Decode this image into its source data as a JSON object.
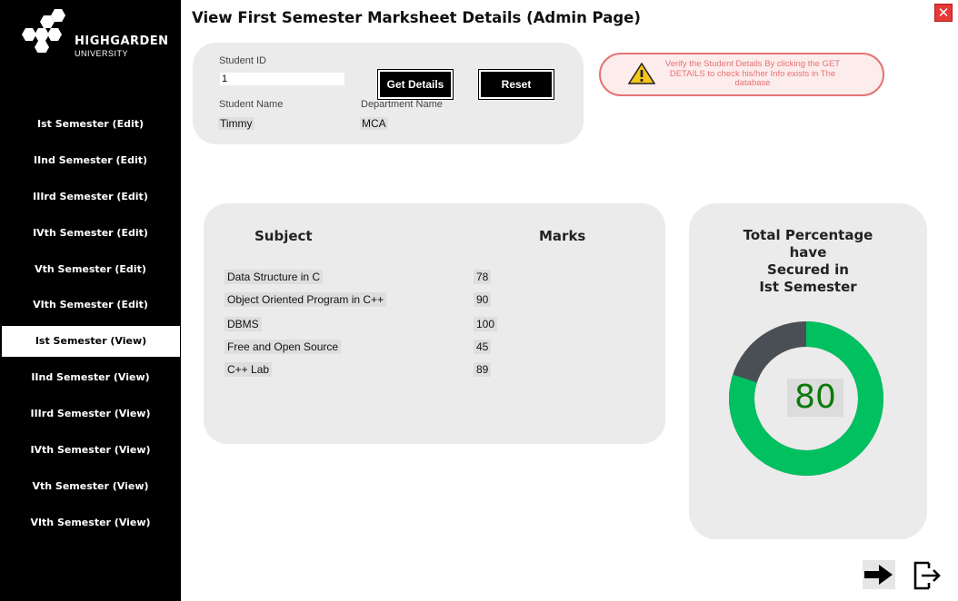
{
  "logo": {
    "name": "HIGHGARDEN",
    "sub": "UNIVERSITY"
  },
  "sidebar": {
    "items": [
      {
        "label": "Ist Semester (Edit)"
      },
      {
        "label": "IInd Semester (Edit)"
      },
      {
        "label": "IIIrd Semester (Edit)"
      },
      {
        "label": "IVth Semester (Edit)"
      },
      {
        "label": "Vth Semester (Edit)"
      },
      {
        "label": "VIth Semester (Edit)"
      },
      {
        "label": "Ist Semester (View)",
        "active": true
      },
      {
        "label": "IInd Semester (View)"
      },
      {
        "label": "IIIrd Semester (View)"
      },
      {
        "label": "IVth Semester (View)"
      },
      {
        "label": "Vth Semester (View)"
      },
      {
        "label": "VIth Semester (View)"
      }
    ]
  },
  "header": {
    "title": "View First Semester Marksheet Details (Admin Page)",
    "close_label": "✕"
  },
  "student": {
    "id_label": "Student ID",
    "id_value": "1",
    "name_label": "Student Name",
    "name_value": "Timmy",
    "dept_label": "Department Name",
    "dept_value": "MCA",
    "get_details_label": "Get Details",
    "reset_label": "Reset"
  },
  "warning": {
    "icon": "warning-icon",
    "text": "Verify the Student Details By clicking the GET DETAILS to check his/her Info exists in The database"
  },
  "marks": {
    "subject_header": "Subject",
    "marks_header": "Marks",
    "rows": [
      {
        "subject": "Data Structure in C",
        "marks": "78"
      },
      {
        "subject": "Object Oriented Program in C++",
        "marks": "90"
      },
      {
        "subject": "DBMS",
        "marks": "100"
      },
      {
        "subject": "Free and Open Source",
        "marks": "45"
      },
      {
        "subject": "C++ Lab",
        "marks": "89"
      }
    ]
  },
  "percentage": {
    "title_lines": [
      "Total Percentage",
      "have",
      "Secured in",
      "Ist Semester"
    ],
    "value": "80",
    "fraction": 0.8,
    "fill_color": "#00c060",
    "track_color": "#4a4f55",
    "value_color": "#0a7a0a"
  },
  "actions": {
    "next_icon": "arrow-right-icon",
    "logout_icon": "logout-icon"
  },
  "colors": {
    "sidebar_bg": "#000000",
    "panel_bg": "#ebebeb",
    "warning_border": "#e57373"
  }
}
